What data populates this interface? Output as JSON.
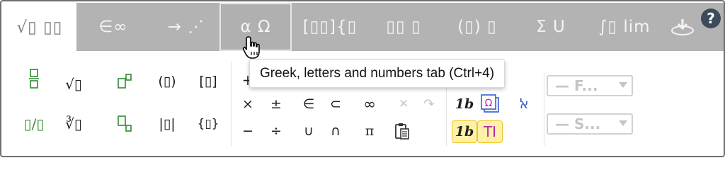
{
  "tabs": [
    {
      "id": "fractions",
      "label": "√▯ ▯▯",
      "selected": true
    },
    {
      "id": "sets",
      "label": "∈∞"
    },
    {
      "id": "arrows",
      "label": "→ ⋰"
    },
    {
      "id": "greek",
      "label": "α Ω",
      "hover": true
    },
    {
      "id": "matrices",
      "label": "[▯▯]{▯"
    },
    {
      "id": "scripts",
      "label": "▯▯ ▯"
    },
    {
      "id": "brackets",
      "label": "(▯) ▯"
    },
    {
      "id": "operators",
      "label": "Σ U"
    },
    {
      "id": "calculus",
      "label": "∫▯ lim"
    },
    {
      "id": "accessibility",
      "label": ""
    }
  ],
  "help_label": "?",
  "tooltip": "Greek, letters and numbers tab (Ctrl+4)",
  "tools": {
    "row1": [
      "▯/▯",
      "√▯",
      "▯▯",
      "(▯)",
      "[▯]",
      "+"
    ],
    "row2": [
      "▯/▯",
      "∛▯",
      "▯▯",
      "|▯|",
      "{▯}",
      "×",
      "±",
      "∈",
      "⊂",
      "∞",
      "✕",
      "↷",
      "1b",
      "Ω",
      "ﭏ"
    ],
    "row3": [
      "−",
      "÷",
      "∪",
      "∩",
      "π",
      "📋",
      "1b",
      "T"
    ]
  },
  "dropdowns": {
    "font": "— F...",
    "size": "— S..."
  }
}
